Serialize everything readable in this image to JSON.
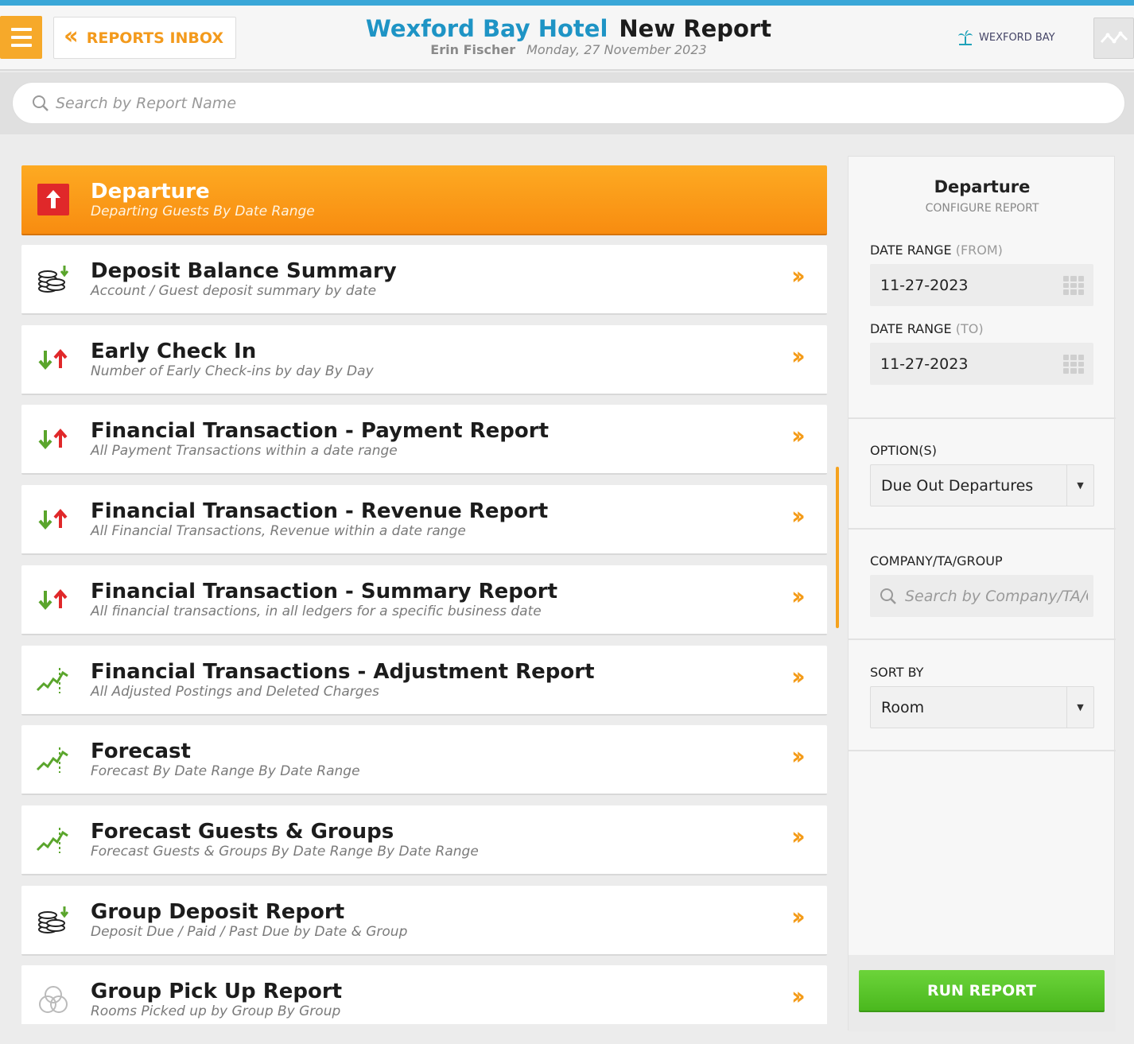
{
  "header": {
    "back_label": "REPORTS INBOX",
    "hotel_name": "Wexford Bay Hotel",
    "page_title": "New Report",
    "user_name": "Erin Fischer",
    "date": "Monday, 27 November 2023",
    "brand_label": "WEXFORD BAY"
  },
  "search": {
    "placeholder": "Search by Report Name"
  },
  "reports": [
    {
      "title": "Departure",
      "description": "Departing Guests By Date Range",
      "icon": "departure-arrow-icon",
      "active": true
    },
    {
      "title": "Deposit Balance Summary",
      "description": "Account / Guest deposit summary by date",
      "icon": "coins-icon"
    },
    {
      "title": "Early Check In",
      "description": "Number of Early Check-ins by day By Day",
      "icon": "arrows-up-down-icon"
    },
    {
      "title": "Financial Transaction - Payment Report",
      "description": "All Payment Transactions within a date range",
      "icon": "arrows-up-down-icon"
    },
    {
      "title": "Financial Transaction - Revenue Report",
      "description": "All Financial Transactions, Revenue within a date range",
      "icon": "arrows-up-down-icon"
    },
    {
      "title": "Financial Transaction - Summary Report",
      "description": "All financial transactions, in all ledgers for a specific business date",
      "icon": "arrows-up-down-icon"
    },
    {
      "title": "Financial Transactions - Adjustment Report",
      "description": "All Adjusted Postings and Deleted Charges",
      "icon": "trend-line-icon"
    },
    {
      "title": "Forecast",
      "description": "Forecast By Date Range By Date Range",
      "icon": "trend-line-icon"
    },
    {
      "title": "Forecast Guests & Groups",
      "description": "Forecast Guests & Groups By Date Range By Date Range",
      "icon": "trend-line-icon"
    },
    {
      "title": "Group Deposit Report",
      "description": "Deposit Due / Paid / Past Due by Date & Group",
      "icon": "coins-icon"
    },
    {
      "title": "Group Pick Up Report",
      "description": "Rooms Picked up by Group By Group",
      "icon": "circles-icon"
    }
  ],
  "config": {
    "title": "Departure",
    "subtitle": "CONFIGURE REPORT",
    "date_from_label": "DATE RANGE",
    "date_from_suffix": "(FROM)",
    "date_from_value": "11-27-2023",
    "date_to_label": "DATE RANGE",
    "date_to_suffix": "(TO)",
    "date_to_value": "11-27-2023",
    "options_label": "OPTION(S)",
    "options_value": "Due Out Departures",
    "company_label": "COMPANY/TA/GROUP",
    "company_placeholder": "Search by Company/TA/Group",
    "sort_label": "SORT BY",
    "sort_value": "Room",
    "run_label": "RUN REPORT"
  },
  "colors": {
    "accent_orange": "#f88c10",
    "brand_blue": "#1e94c5",
    "run_green": "#4ab81e",
    "arrow_red": "#e0282a",
    "arrow_green": "#5aa52c"
  }
}
